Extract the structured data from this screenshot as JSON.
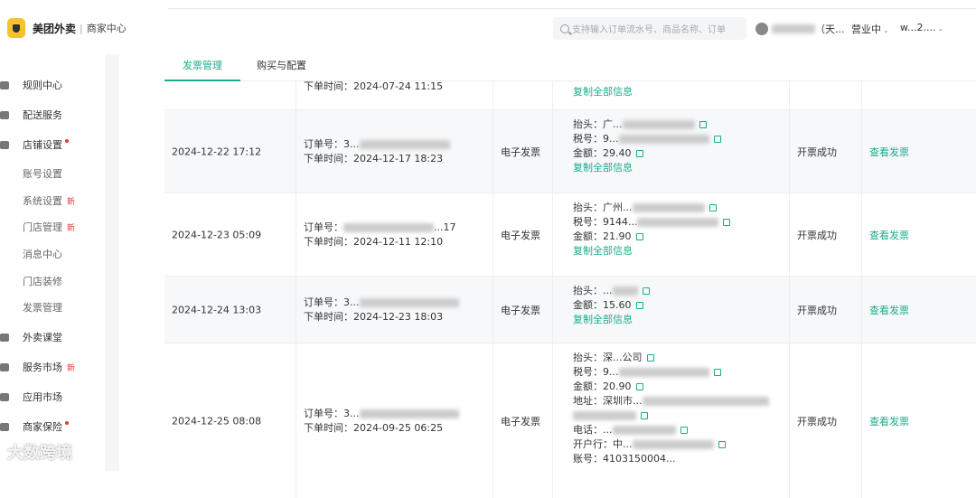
{
  "header": {
    "brand": "美团外卖",
    "brand_sub": "商家中心",
    "search_placeholder": "支持输入订单流水号、商品名称、订单",
    "user_suffix": "（天...",
    "status": "营业中",
    "account": "w...2...."
  },
  "sidebar": {
    "items": [
      {
        "label": "规则中心",
        "type": "main",
        "icon": "book-icon"
      },
      {
        "label": "配送服务",
        "type": "main",
        "icon": "scooter-icon"
      },
      {
        "label": "店铺设置",
        "type": "main",
        "icon": "gear-icon",
        "dot": true
      },
      {
        "label": "账号设置",
        "type": "sub"
      },
      {
        "label": "系统设置",
        "type": "sub",
        "badge": "新"
      },
      {
        "label": "门店管理",
        "type": "sub",
        "badge": "新"
      },
      {
        "label": "消息中心",
        "type": "sub"
      },
      {
        "label": "门店装修",
        "type": "sub"
      },
      {
        "label": "发票管理",
        "type": "sub"
      },
      {
        "label": "外卖课堂",
        "type": "main",
        "icon": "book-open-icon"
      },
      {
        "label": "服务市场",
        "type": "main",
        "icon": "diamond-icon",
        "badge": "新"
      },
      {
        "label": "应用市场",
        "type": "main",
        "icon": "bag-icon"
      },
      {
        "label": "商家保险",
        "type": "main",
        "icon": "shield-icon",
        "dot": true
      }
    ]
  },
  "tabs": [
    {
      "label": "发票管理",
      "active": true
    },
    {
      "label": "购买与配置",
      "active": false
    }
  ],
  "labels": {
    "order_no": "订单号：",
    "order_time": "下单时间：",
    "copy_all": "复制全部信息",
    "view_invoice": "查看发票",
    "title": "抬头：",
    "tax_no": "税号：",
    "amount": "金额：",
    "address": "地址：",
    "phone": "电话：",
    "bank": "开户行：",
    "account_no": "账号："
  },
  "rows": [
    {
      "date": "",
      "order_no": "",
      "order_time": "2024-07-24 11:15",
      "type": "",
      "status": "",
      "info_tail": "复制全部信息"
    },
    {
      "date": "2024-12-22 17:12",
      "order_no": "3...",
      "order_time": "2024-12-17 18:23",
      "type": "电子发票",
      "title": "广...",
      "tax_no": "9...",
      "amount": "29.40",
      "status": "开票成功"
    },
    {
      "date": "2024-12-23 05:09",
      "order_no": "...17",
      "order_time": "2024-12-11 12:10",
      "type": "电子发票",
      "title": "广州...",
      "tax_no": "9144...",
      "amount": "21.90",
      "status": "开票成功"
    },
    {
      "date": "2024-12-24 13:03",
      "order_no": "3...",
      "order_time": "2024-12-23 18:03",
      "type": "电子发票",
      "title": "...",
      "amount": "15.60",
      "status": "开票成功"
    },
    {
      "date": "2024-12-25 08:08",
      "order_no": "3...",
      "order_time": "2024-09-25 06:25",
      "type": "电子发票",
      "title": "深...公司",
      "tax_no": "9...",
      "amount": "20.90",
      "address": "深圳市...",
      "phone": "...",
      "bank": "中...",
      "account_no": "4103150004...",
      "status": "开票成功"
    }
  ],
  "watermark": "大数跨境"
}
